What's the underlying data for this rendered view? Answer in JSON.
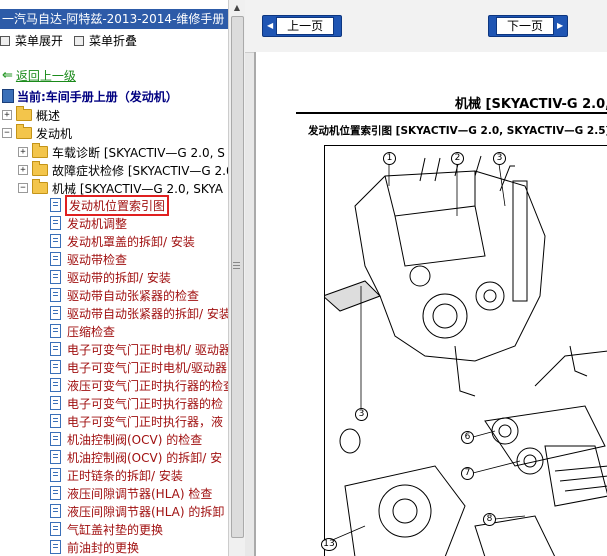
{
  "window_title": "一汽马自达-阿特兹-2013-2014-维修手册",
  "menu": {
    "expand": "菜单展开",
    "collapse": "菜单折叠"
  },
  "back_link": "返回上一级",
  "current": "当前:车间手册上册（发动机）",
  "tree": {
    "overview": "概述",
    "engine": "发动机",
    "onboard_diag": "车载诊断 [SKYACTIV—G 2.0, S",
    "troubleshoot": "故障症状检修 [SKYACTIV—G 2.0",
    "mechanical": "机械 [SKYACTIV—G 2.0, SKYA",
    "items": [
      "发动机位置索引图",
      "发动机调整",
      "发动机罩盖的拆卸/ 安装",
      "驱动带检查",
      "驱动带的拆卸/ 安装",
      "驱动带自动张紧器的检查",
      "驱动带自动张紧器的拆卸/ 安装",
      "压缩检查",
      "电子可变气门正时电机/ 驱动器",
      "电子可变气门正时电机/驱动器",
      "液压可变气门正时执行器的检查",
      "电子可变气门正时执行器的检",
      "电子可变气门正时执行器，液",
      "机油控制阀(OCV) 的检查",
      "机油控制阀(OCV) 的拆卸/ 安",
      "正时链条的拆卸/ 安装",
      "液压间隙调节器(HLA) 检查",
      "液压间隙调节器(HLA) 的拆卸",
      "气缸盖衬垫的更换",
      "前油封的更换"
    ]
  },
  "nav": {
    "prev": "上一页",
    "next": "下一页"
  },
  "document": {
    "heading": "机械 [SKYACTIV-G 2.0, S",
    "subheading": "发动机位置索引图 [SKYACTIV—G 2.0, SKYACTIV—G 2.5]",
    "callouts": [
      "1",
      "2",
      "3",
      "3",
      "6",
      "7",
      "8",
      "13"
    ]
  }
}
